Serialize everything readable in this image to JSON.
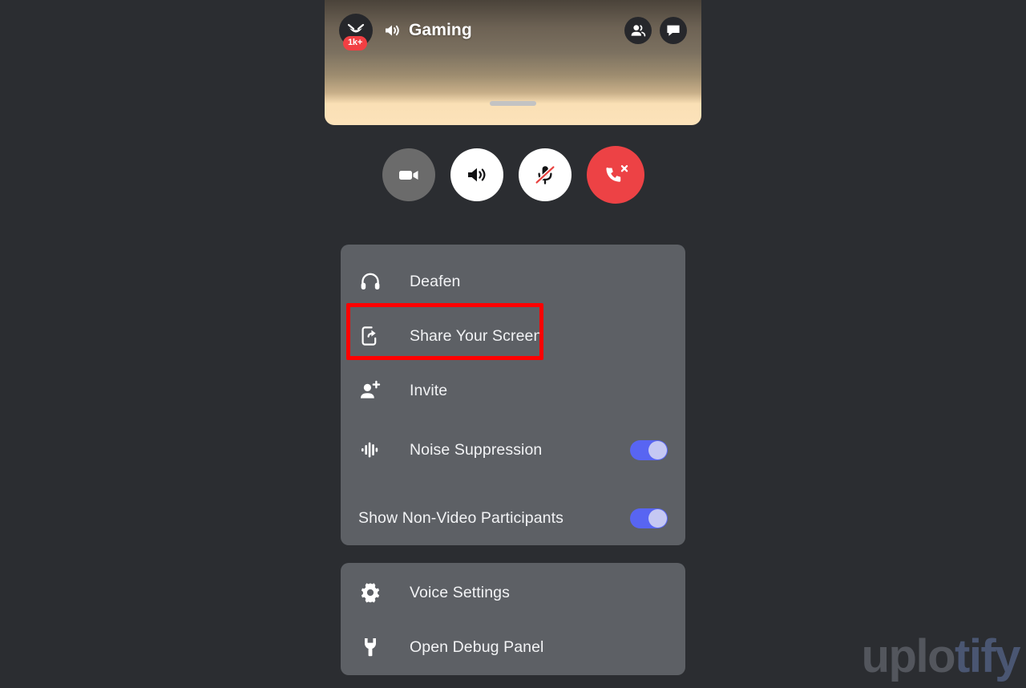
{
  "app": {
    "background_color": "#2b2d31",
    "card_color": "#5d6065",
    "accent_color": "#5865f2",
    "danger_color": "#ed4245",
    "highlight_color": "#ff0000"
  },
  "call_panel": {
    "channel_name": "Gaming",
    "channel_icon": "volume-speaker-icon",
    "avatar_icon": "server-avatar-icon",
    "avatar_badge": "1k+",
    "members_icon": "members-icon",
    "chat_icon": "chat-bubble-icon",
    "drag_handle": "drag-handle"
  },
  "controls": [
    {
      "name": "video-toggle-button",
      "icon": "video-camera-icon",
      "state": "off",
      "bg": "#6b6b6b"
    },
    {
      "name": "speaker-button",
      "icon": "speaker-icon",
      "state": "on",
      "bg": "#ffffff"
    },
    {
      "name": "mic-mute-button",
      "icon": "mic-muted-icon",
      "state": "muted",
      "bg": "#ffffff"
    },
    {
      "name": "disconnect-button",
      "icon": "phone-hangup-icon",
      "state": "active",
      "bg": "#ed4245"
    }
  ],
  "menu": {
    "items": [
      {
        "label": "Deafen",
        "icon": "headphones-icon",
        "type": "action",
        "highlighted": false
      },
      {
        "label": "Share Your Screen",
        "icon": "screen-share-icon",
        "type": "action",
        "highlighted": true
      },
      {
        "label": "Invite",
        "icon": "person-add-icon",
        "type": "action",
        "highlighted": false
      },
      {
        "label": "Noise Suppression",
        "icon": "waveform-icon",
        "type": "toggle",
        "toggle_on": true
      },
      {
        "label": "Show Non-Video Participants",
        "icon": null,
        "type": "toggle",
        "toggle_on": true
      }
    ]
  },
  "settings_menu": {
    "items": [
      {
        "label": "Voice Settings",
        "icon": "gear-icon"
      },
      {
        "label": "Open Debug Panel",
        "icon": "wrench-icon"
      }
    ]
  },
  "watermark": {
    "part1": "uplo",
    "part2": "tify"
  }
}
